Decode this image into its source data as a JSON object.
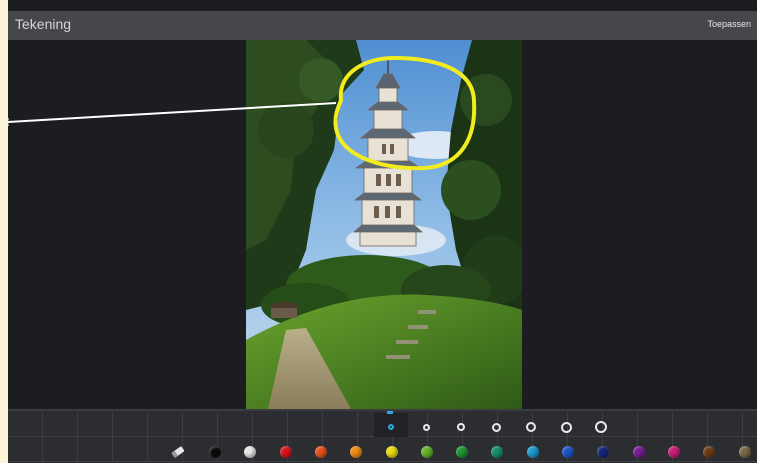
{
  "header": {
    "title": "Tekening",
    "apply_label": "Toepassen"
  },
  "colors": {
    "header_bg": "#45474b",
    "app_bg": "#1a1c1f",
    "toolbar_bg": "#2b2d31",
    "selection_accent": "#2aa6e0",
    "drawing_stroke": "#f2ec1e",
    "line_stroke": "#ffffff"
  },
  "canvas": {
    "image_subject": "pagoda-tower-in-park",
    "annotation": "yellow-hand-drawn-circle",
    "zoom_icon": "zoom-in-icon"
  },
  "toolbar": {
    "brush_sizes": [
      {
        "name": "brush-size-1",
        "selected": true
      },
      {
        "name": "brush-size-2",
        "selected": false
      },
      {
        "name": "brush-size-3",
        "selected": false
      },
      {
        "name": "brush-size-4",
        "selected": false
      },
      {
        "name": "brush-size-5",
        "selected": false
      },
      {
        "name": "brush-size-6",
        "selected": false
      },
      {
        "name": "brush-size-7",
        "selected": false
      }
    ],
    "eraser_icon": "eraser-icon",
    "palette": [
      {
        "name": "black",
        "hex": "#0a0a0a"
      },
      {
        "name": "white",
        "hex": "#e6e6e6"
      },
      {
        "name": "red",
        "hex": "#d8141c"
      },
      {
        "name": "orange-red",
        "hex": "#e8501a"
      },
      {
        "name": "orange",
        "hex": "#f08a14"
      },
      {
        "name": "yellow",
        "hex": "#e8dc14"
      },
      {
        "name": "light-green",
        "hex": "#64b42a"
      },
      {
        "name": "green",
        "hex": "#1e9632"
      },
      {
        "name": "teal",
        "hex": "#178c6e"
      },
      {
        "name": "light-blue",
        "hex": "#1e9ad2"
      },
      {
        "name": "blue",
        "hex": "#1e56c8"
      },
      {
        "name": "navy",
        "hex": "#14287a"
      },
      {
        "name": "purple",
        "hex": "#7a1e96"
      },
      {
        "name": "magenta",
        "hex": "#c81e78"
      },
      {
        "name": "brown",
        "hex": "#6e3c14"
      },
      {
        "name": "khaki",
        "hex": "#7a6a4a"
      }
    ]
  }
}
